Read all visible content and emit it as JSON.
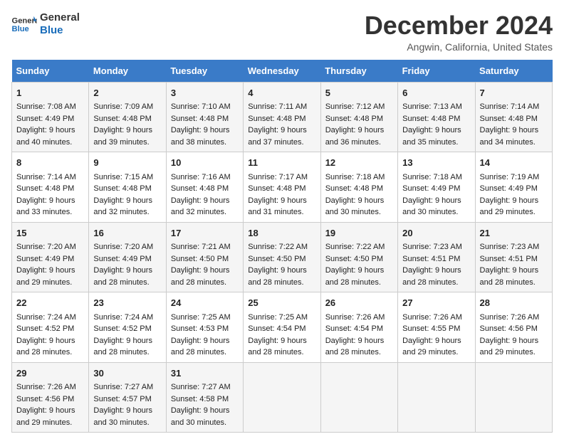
{
  "logo": {
    "line1": "General",
    "line2": "Blue"
  },
  "title": "December 2024",
  "subtitle": "Angwin, California, United States",
  "days_header": [
    "Sunday",
    "Monday",
    "Tuesday",
    "Wednesday",
    "Thursday",
    "Friday",
    "Saturday"
  ],
  "weeks": [
    [
      {
        "day": "1",
        "sunrise": "Sunrise: 7:08 AM",
        "sunset": "Sunset: 4:49 PM",
        "daylight": "Daylight: 9 hours and 40 minutes."
      },
      {
        "day": "2",
        "sunrise": "Sunrise: 7:09 AM",
        "sunset": "Sunset: 4:48 PM",
        "daylight": "Daylight: 9 hours and 39 minutes."
      },
      {
        "day": "3",
        "sunrise": "Sunrise: 7:10 AM",
        "sunset": "Sunset: 4:48 PM",
        "daylight": "Daylight: 9 hours and 38 minutes."
      },
      {
        "day": "4",
        "sunrise": "Sunrise: 7:11 AM",
        "sunset": "Sunset: 4:48 PM",
        "daylight": "Daylight: 9 hours and 37 minutes."
      },
      {
        "day": "5",
        "sunrise": "Sunrise: 7:12 AM",
        "sunset": "Sunset: 4:48 PM",
        "daylight": "Daylight: 9 hours and 36 minutes."
      },
      {
        "day": "6",
        "sunrise": "Sunrise: 7:13 AM",
        "sunset": "Sunset: 4:48 PM",
        "daylight": "Daylight: 9 hours and 35 minutes."
      },
      {
        "day": "7",
        "sunrise": "Sunrise: 7:14 AM",
        "sunset": "Sunset: 4:48 PM",
        "daylight": "Daylight: 9 hours and 34 minutes."
      }
    ],
    [
      {
        "day": "8",
        "sunrise": "Sunrise: 7:14 AM",
        "sunset": "Sunset: 4:48 PM",
        "daylight": "Daylight: 9 hours and 33 minutes."
      },
      {
        "day": "9",
        "sunrise": "Sunrise: 7:15 AM",
        "sunset": "Sunset: 4:48 PM",
        "daylight": "Daylight: 9 hours and 32 minutes."
      },
      {
        "day": "10",
        "sunrise": "Sunrise: 7:16 AM",
        "sunset": "Sunset: 4:48 PM",
        "daylight": "Daylight: 9 hours and 32 minutes."
      },
      {
        "day": "11",
        "sunrise": "Sunrise: 7:17 AM",
        "sunset": "Sunset: 4:48 PM",
        "daylight": "Daylight: 9 hours and 31 minutes."
      },
      {
        "day": "12",
        "sunrise": "Sunrise: 7:18 AM",
        "sunset": "Sunset: 4:48 PM",
        "daylight": "Daylight: 9 hours and 30 minutes."
      },
      {
        "day": "13",
        "sunrise": "Sunrise: 7:18 AM",
        "sunset": "Sunset: 4:49 PM",
        "daylight": "Daylight: 9 hours and 30 minutes."
      },
      {
        "day": "14",
        "sunrise": "Sunrise: 7:19 AM",
        "sunset": "Sunset: 4:49 PM",
        "daylight": "Daylight: 9 hours and 29 minutes."
      }
    ],
    [
      {
        "day": "15",
        "sunrise": "Sunrise: 7:20 AM",
        "sunset": "Sunset: 4:49 PM",
        "daylight": "Daylight: 9 hours and 29 minutes."
      },
      {
        "day": "16",
        "sunrise": "Sunrise: 7:20 AM",
        "sunset": "Sunset: 4:49 PM",
        "daylight": "Daylight: 9 hours and 28 minutes."
      },
      {
        "day": "17",
        "sunrise": "Sunrise: 7:21 AM",
        "sunset": "Sunset: 4:50 PM",
        "daylight": "Daylight: 9 hours and 28 minutes."
      },
      {
        "day": "18",
        "sunrise": "Sunrise: 7:22 AM",
        "sunset": "Sunset: 4:50 PM",
        "daylight": "Daylight: 9 hours and 28 minutes."
      },
      {
        "day": "19",
        "sunrise": "Sunrise: 7:22 AM",
        "sunset": "Sunset: 4:50 PM",
        "daylight": "Daylight: 9 hours and 28 minutes."
      },
      {
        "day": "20",
        "sunrise": "Sunrise: 7:23 AM",
        "sunset": "Sunset: 4:51 PM",
        "daylight": "Daylight: 9 hours and 28 minutes."
      },
      {
        "day": "21",
        "sunrise": "Sunrise: 7:23 AM",
        "sunset": "Sunset: 4:51 PM",
        "daylight": "Daylight: 9 hours and 28 minutes."
      }
    ],
    [
      {
        "day": "22",
        "sunrise": "Sunrise: 7:24 AM",
        "sunset": "Sunset: 4:52 PM",
        "daylight": "Daylight: 9 hours and 28 minutes."
      },
      {
        "day": "23",
        "sunrise": "Sunrise: 7:24 AM",
        "sunset": "Sunset: 4:52 PM",
        "daylight": "Daylight: 9 hours and 28 minutes."
      },
      {
        "day": "24",
        "sunrise": "Sunrise: 7:25 AM",
        "sunset": "Sunset: 4:53 PM",
        "daylight": "Daylight: 9 hours and 28 minutes."
      },
      {
        "day": "25",
        "sunrise": "Sunrise: 7:25 AM",
        "sunset": "Sunset: 4:54 PM",
        "daylight": "Daylight: 9 hours and 28 minutes."
      },
      {
        "day": "26",
        "sunrise": "Sunrise: 7:26 AM",
        "sunset": "Sunset: 4:54 PM",
        "daylight": "Daylight: 9 hours and 28 minutes."
      },
      {
        "day": "27",
        "sunrise": "Sunrise: 7:26 AM",
        "sunset": "Sunset: 4:55 PM",
        "daylight": "Daylight: 9 hours and 29 minutes."
      },
      {
        "day": "28",
        "sunrise": "Sunrise: 7:26 AM",
        "sunset": "Sunset: 4:56 PM",
        "daylight": "Daylight: 9 hours and 29 minutes."
      }
    ],
    [
      {
        "day": "29",
        "sunrise": "Sunrise: 7:26 AM",
        "sunset": "Sunset: 4:56 PM",
        "daylight": "Daylight: 9 hours and 29 minutes."
      },
      {
        "day": "30",
        "sunrise": "Sunrise: 7:27 AM",
        "sunset": "Sunset: 4:57 PM",
        "daylight": "Daylight: 9 hours and 30 minutes."
      },
      {
        "day": "31",
        "sunrise": "Sunrise: 7:27 AM",
        "sunset": "Sunset: 4:58 PM",
        "daylight": "Daylight: 9 hours and 30 minutes."
      },
      null,
      null,
      null,
      null
    ]
  ]
}
